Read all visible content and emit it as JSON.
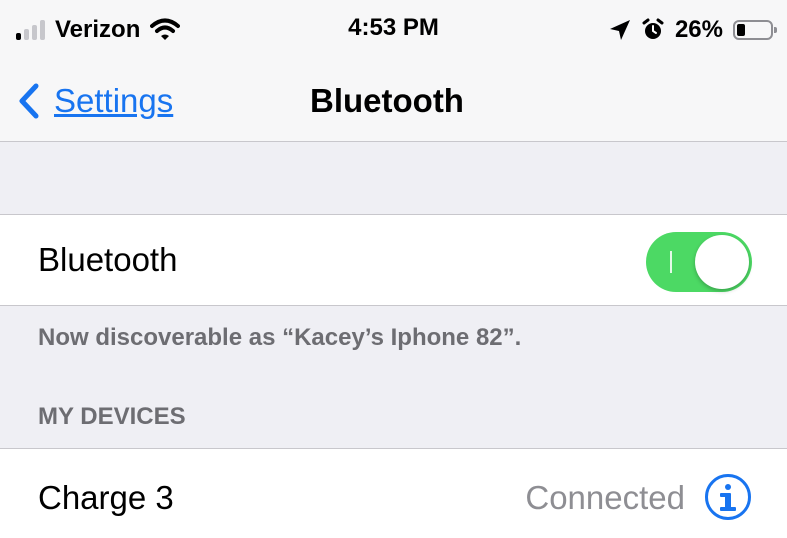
{
  "status_bar": {
    "carrier": "Verizon",
    "time": "4:53 PM",
    "battery_percent": "26%",
    "battery_level": 0.26,
    "signal_bars_on": 1,
    "signal_bars_total": 4
  },
  "nav": {
    "back_label": "Settings",
    "title": "Bluetooth"
  },
  "bluetooth": {
    "label": "Bluetooth",
    "enabled": true,
    "discoverable_text": "Now discoverable as “Kacey’s Iphone 82”."
  },
  "my_devices": {
    "header": "MY DEVICES",
    "devices": [
      {
        "name": "Charge 3",
        "status": "Connected"
      }
    ]
  },
  "colors": {
    "accent": "#1874f0",
    "toggle_on": "#4cd964",
    "background": "#efeff4",
    "secondary_text": "#6d6d72"
  },
  "icons": [
    "wifi-icon",
    "location-arrow-icon",
    "alarm-icon",
    "battery-icon",
    "chevron-left-icon",
    "info-icon"
  ]
}
